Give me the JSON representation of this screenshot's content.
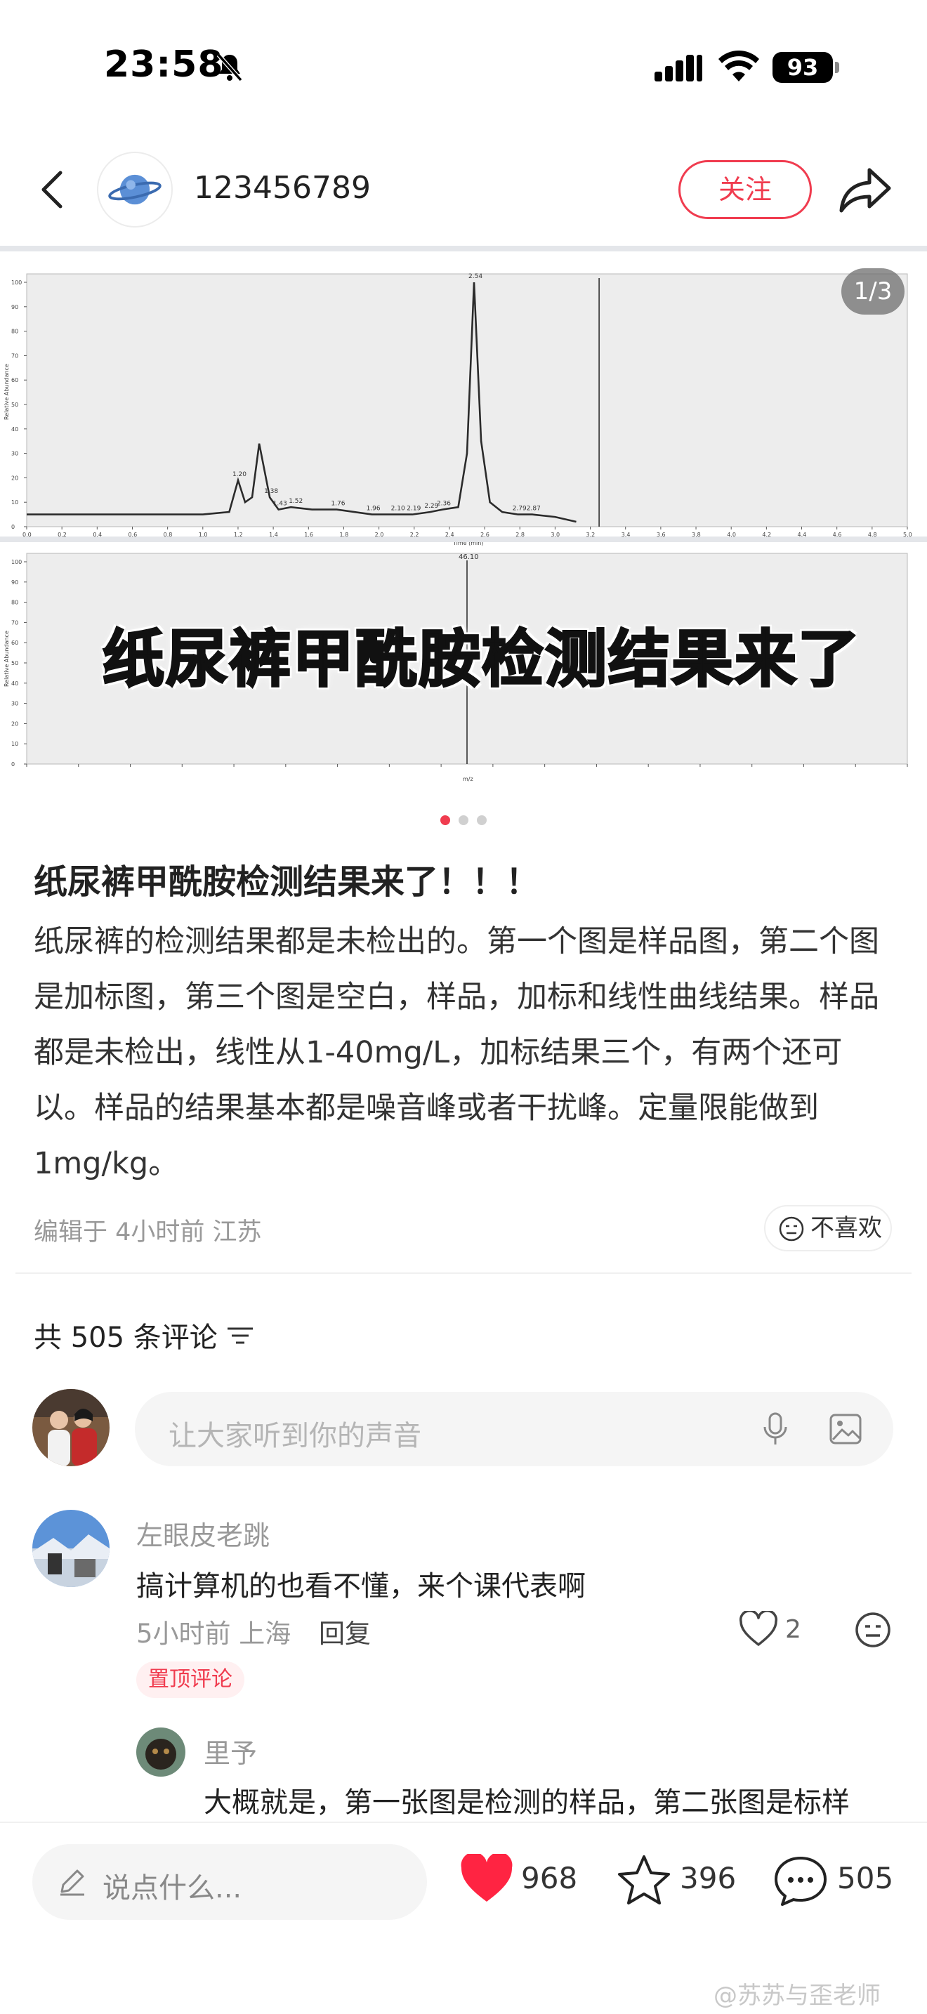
{
  "status_bar": {
    "time": "23:58",
    "battery": "93"
  },
  "header": {
    "username": "123456789",
    "follow_label": "关注"
  },
  "carousel": {
    "page_indicator": "1/3",
    "overlay_title": "纸尿裤甲酰胺检测结果来了",
    "dots": 3,
    "active_dot": 0
  },
  "post": {
    "title": "纸尿裤甲酰胺检测结果来了！！！",
    "body": "纸尿裤的检测结果都是未检出的。第一个图是样品图，第二个图是加标图，第三个图是空白，样品，加标和线性曲线结果。样品都是未检出，线性从1-40mg/L，加标结果三个，有两个还可以。样品的结果基本都是噪音峰或者干扰峰。定量限能做到1mg/kg。",
    "meta": "编辑于 4小时前 江苏",
    "dislike_label": "不喜欢"
  },
  "comments": {
    "count_label": "共 505 条评论",
    "input_placeholder": "让大家听到你的声音",
    "items": [
      {
        "name": "左眼皮老跳",
        "text": "搞计算机的也看不懂，来个课代表啊",
        "meta": "5小时前 上海",
        "reply_label": "回复",
        "likes": "2",
        "badge": "置顶评论"
      }
    ],
    "reply": {
      "name": "里予",
      "text": "大概就是，第一张图是检测的样品，第二张图是标样"
    }
  },
  "bottom_bar": {
    "input_placeholder": "说点什么...",
    "likes": "968",
    "favorites": "396",
    "comments": "505",
    "watermark": "@苏苏与歪老师"
  },
  "colors": {
    "accent": "#f03c4f",
    "liked_heart": "#ff2442"
  },
  "chart_data": [
    {
      "type": "line",
      "xlabel": "Time (min)",
      "ylabel": "Relative Abundance",
      "xlim": [
        0.0,
        5.0
      ],
      "ylim": [
        0,
        100
      ],
      "x": [
        0.0,
        0.5,
        1.0,
        1.15,
        1.2,
        1.24,
        1.28,
        1.32,
        1.38,
        1.43,
        1.5,
        1.62,
        1.76,
        1.96,
        2.1,
        2.19,
        2.29,
        2.36,
        2.45,
        2.5,
        2.54,
        2.58,
        2.63,
        2.7,
        2.79,
        2.87,
        3.0,
        3.12
      ],
      "y": [
        5,
        5,
        5,
        6,
        19,
        10,
        12,
        34,
        12,
        7,
        8,
        7,
        7,
        5,
        5,
        5,
        6,
        7,
        8,
        30,
        100,
        35,
        10,
        6,
        5,
        5,
        4,
        2
      ],
      "peak_labels": [
        {
          "x": 1.2,
          "label": "1.20"
        },
        {
          "x": 1.38,
          "label": "1.38"
        },
        {
          "x": 1.43,
          "label": "1.43"
        },
        {
          "x": 1.52,
          "label": "1.52"
        },
        {
          "x": 1.76,
          "label": "1.76"
        },
        {
          "x": 1.96,
          "label": "1.96"
        },
        {
          "x": 2.1,
          "label": "2.10"
        },
        {
          "x": 2.19,
          "label": "2.19"
        },
        {
          "x": 2.29,
          "label": "2.29"
        },
        {
          "x": 2.36,
          "label": "2.36"
        },
        {
          "x": 2.54,
          "label": "2.54"
        },
        {
          "x": 2.79,
          "label": "2.79"
        },
        {
          "x": 2.87,
          "label": "2.87"
        }
      ],
      "marker_x": 3.25,
      "grid": false
    },
    {
      "type": "line",
      "xlabel": "m/z",
      "ylabel": "Relative Abundance",
      "xlim": [
        45.5,
        45.56
      ],
      "ylim": [
        0,
        100
      ],
      "marker_x": 45.53,
      "marker_label": "46.10",
      "grid": false
    }
  ]
}
